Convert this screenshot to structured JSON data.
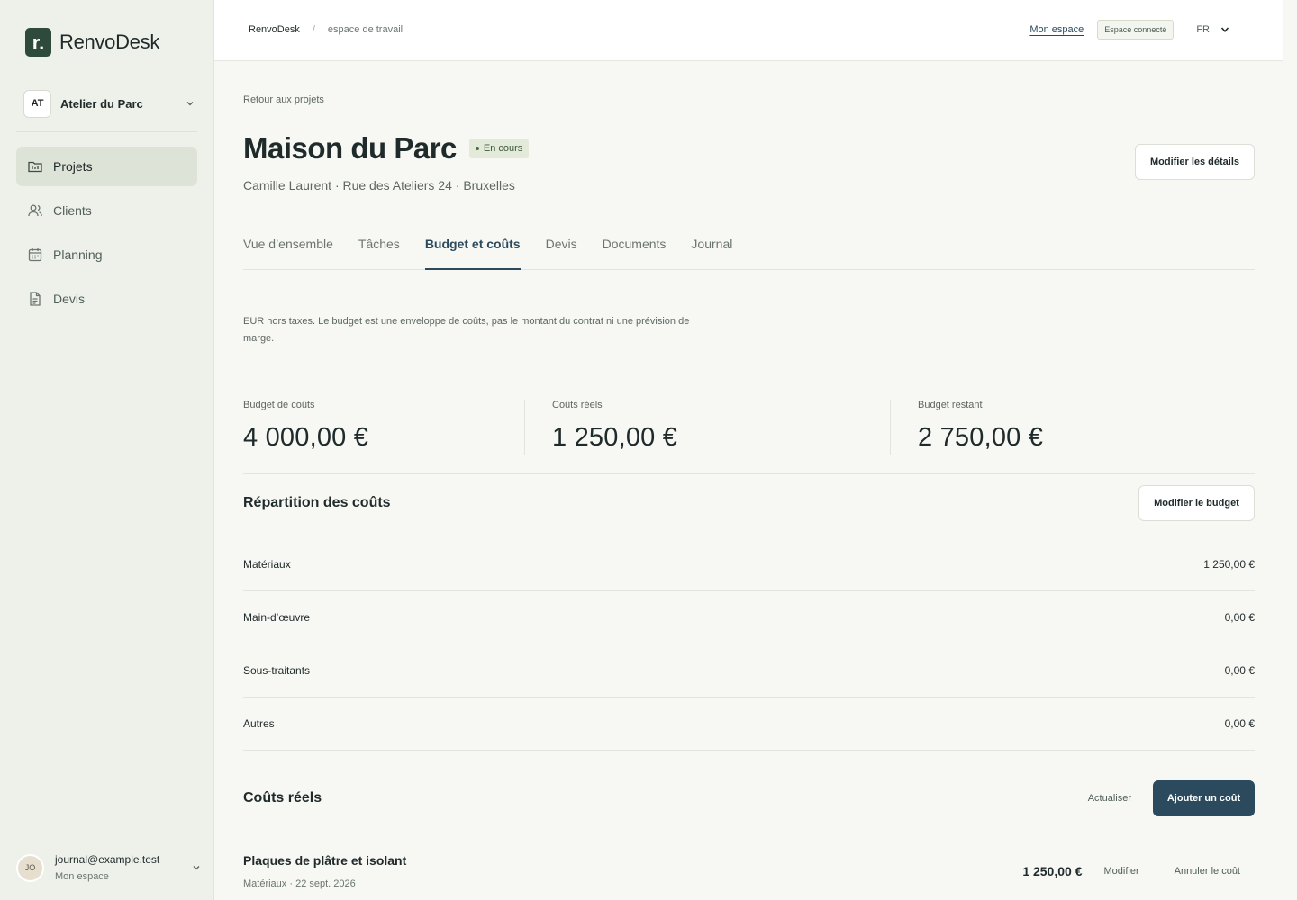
{
  "app": {
    "logo_letter": "r.",
    "name": "RenvoDesk"
  },
  "org": {
    "initials": "AT",
    "name": "Atelier du Parc"
  },
  "nav": [
    {
      "label": "Projets",
      "icon": "folder-icon"
    },
    {
      "label": "Clients",
      "icon": "users-icon"
    },
    {
      "label": "Planning",
      "icon": "calendar-icon"
    },
    {
      "label": "Devis",
      "icon": "document-icon"
    }
  ],
  "user": {
    "initials": "JO",
    "email": "journal@example.test",
    "sub": "Mon espace"
  },
  "topbar": {
    "crumb_root": "RenvoDesk",
    "crumb_sep": "/",
    "crumb_leaf": "espace de travail",
    "my_space": "Mon espace",
    "connected": "Espace connecté",
    "lang": "FR"
  },
  "project": {
    "back": "Retour aux projets",
    "title": "Maison du Parc",
    "status": "En cours",
    "subtitle": "Camille Laurent · Rue des Ateliers 24 · Bruxelles",
    "edit_details": "Modifier les détails"
  },
  "tabs": [
    "Vue d’ensemble",
    "Tâches",
    "Budget et coûts",
    "Devis",
    "Documents",
    "Journal"
  ],
  "note": "EUR hors taxes. Le budget est une enveloppe de coûts, pas le montant du contrat ni une prévision de marge.",
  "stats": [
    {
      "label": "Budget de coûts",
      "value": "4 000,00 €"
    },
    {
      "label": "Coûts réels",
      "value": "1 250,00 €"
    },
    {
      "label": "Budget restant",
      "value": "2 750,00 €"
    }
  ],
  "breakdown": {
    "title": "Répartition des coûts",
    "edit_budget": "Modifier le budget",
    "rows": [
      {
        "label": "Matériaux",
        "amount": "1 250,00 €"
      },
      {
        "label": "Main-d’œuvre",
        "amount": "0,00 €"
      },
      {
        "label": "Sous-traitants",
        "amount": "0,00 €"
      },
      {
        "label": "Autres",
        "amount": "0,00 €"
      }
    ]
  },
  "actual": {
    "title": "Coûts réels",
    "refresh": "Actualiser",
    "add": "Ajouter un coût",
    "item": {
      "name": "Plaques de plâtre et isolant",
      "meta": "Matériaux · 22 sept. 2026",
      "amount": "1 250,00 €",
      "edit": "Modifier",
      "cancel": "Annuler le coût"
    }
  },
  "colors": {
    "accent": "#2b4a5e",
    "brand": "#2e4a3a",
    "status_bg": "#e3ead9"
  }
}
